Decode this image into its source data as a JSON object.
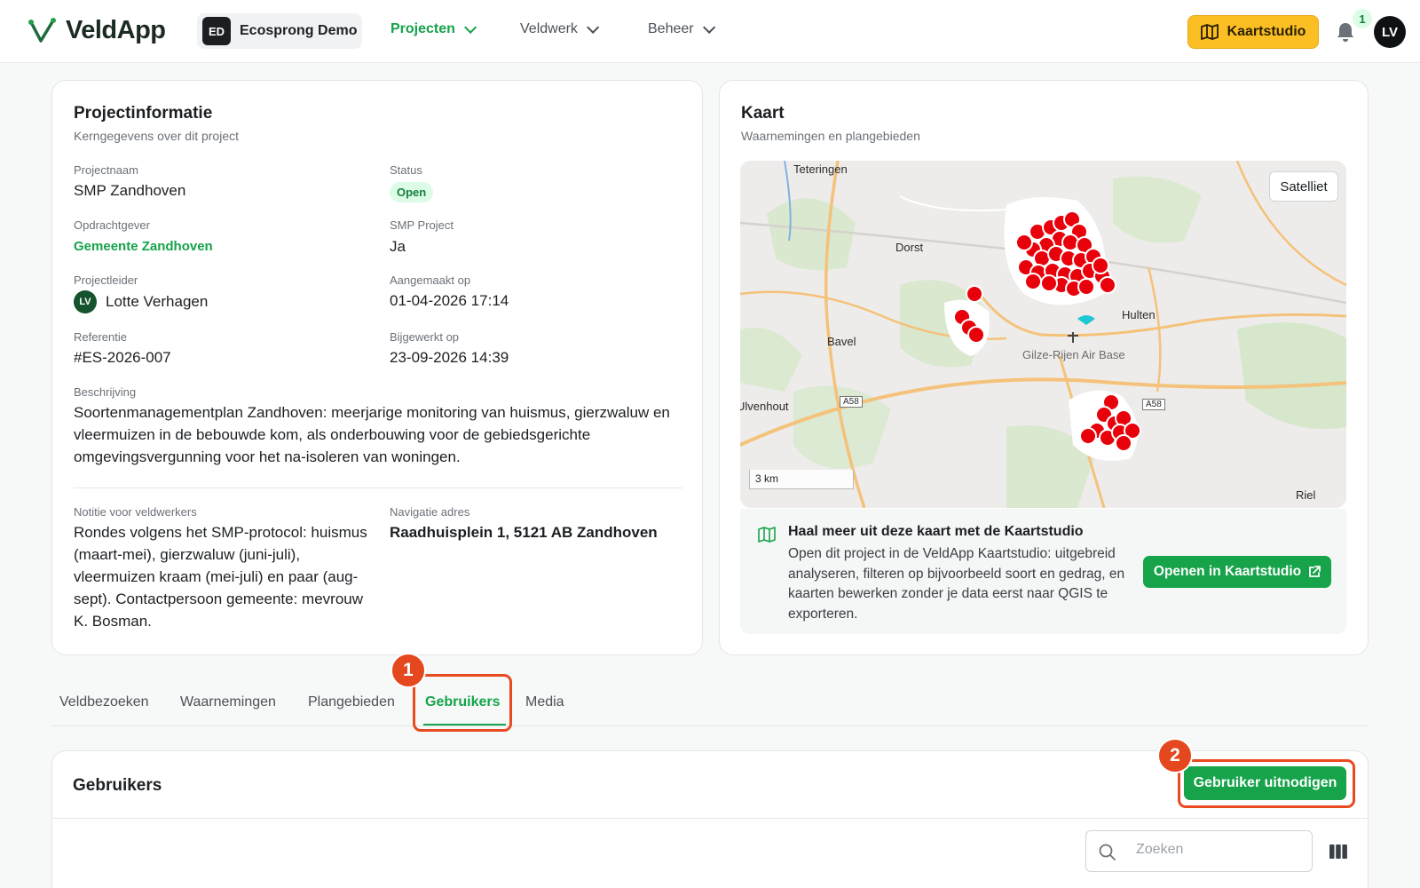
{
  "app": {
    "name": "VeldApp"
  },
  "org": {
    "initials": "ED",
    "name": "Ecosprong Demo"
  },
  "nav": {
    "items": [
      {
        "label": "Projecten"
      },
      {
        "label": "Veldwerk"
      },
      {
        "label": "Beheer"
      }
    ],
    "studio_label": "Kaartstudio",
    "notification_count": "1",
    "user_initials": "LV"
  },
  "info": {
    "title": "Projectinformatie",
    "subtitle": "Kerngegevens over dit project",
    "projectnaam_label": "Projectnaam",
    "projectnaam": "SMP Zandhoven",
    "status_label": "Status",
    "status": "Open",
    "opdrachtgever_label": "Opdrachtgever",
    "opdrachtgever": "Gemeente Zandhoven",
    "smp_label": "SMP Project",
    "smp": "Ja",
    "projectleider_label": "Projectleider",
    "projectleider_initials": "LV",
    "projectleider": "Lotte Verhagen",
    "aangemaakt_label": "Aangemaakt op",
    "aangemaakt": "01-04-2026 17:14",
    "referentie_label": "Referentie",
    "referentie": "#ES-2026-007",
    "bijgewerkt_label": "Bijgewerkt op",
    "bijgewerkt": "23-09-2026 14:39",
    "beschrijving_label": "Beschrijving",
    "beschrijving": "Soortenmanagementplan Zandhoven: meerjarige monitoring van huismus, gierzwaluw en vleermuizen in de bebouwde kom, als onderbouwing voor de gebiedsgerichte omgevingsvergunning voor het na-isoleren van woningen.",
    "notitie_label": "Notitie voor veldwerkers",
    "notitie": "Rondes volgens het SMP-protocol: huismus (maart-mei), gierzwaluw (juni-juli), vleermuizen kraam (mei-juli) en paar (aug-sept). Contactpersoon gemeente: mevrouw K. Bosman.",
    "adres_label": "Navigatie adres",
    "adres": "Raadhuisplein 1, 5121 AB Zandhoven"
  },
  "map": {
    "title": "Kaart",
    "subtitle": "Waarnemingen en plangebieden",
    "satellite_label": "Satelliet",
    "scale_label": "3 km",
    "places": {
      "teteringen": "Teteringen",
      "dorst": "Dorst",
      "bavel": "Bavel",
      "hulten": "Hulten",
      "airbase": "Gilze-Rijen Air Base",
      "ulvenhout": "Ulvenhout",
      "riel": "Riel",
      "road1": "A58",
      "road2": "A58"
    },
    "promo_title": "Haal meer uit deze kaart met de Kaartstudio",
    "promo_text": "Open dit project in de VeldApp Kaartstudio: uitgebreid analyseren, filteren op bijvoorbeeld soort en gedrag, en kaarten bewerken zonder je data eerst naar QGIS te exporteren.",
    "promo_button": "Openen in Kaartstudio",
    "marker_color": "#e8000b"
  },
  "tabs": [
    {
      "label": "Veldbezoeken"
    },
    {
      "label": "Waarnemingen"
    },
    {
      "label": "Plangebieden"
    },
    {
      "label": "Gebruikers"
    },
    {
      "label": "Media"
    }
  ],
  "users": {
    "title": "Gebruikers",
    "invite_button": "Gebruiker uitnodigen",
    "search_placeholder": "Zoeken"
  },
  "steps": [
    "1",
    "2"
  ],
  "colors": {
    "accent": "#16a34a",
    "highlight": "#ea4a1f",
    "studio": "#fbbf24"
  }
}
